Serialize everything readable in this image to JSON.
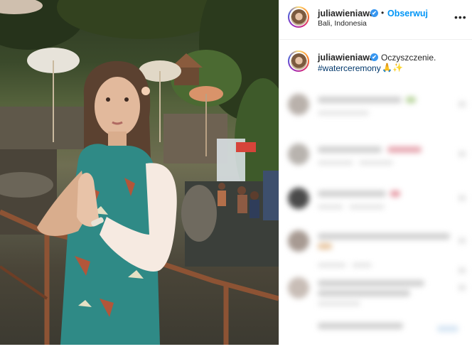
{
  "post": {
    "username": "juliawieniawa",
    "follow_label": "Obserwuj",
    "separator": "•",
    "location": "Bali, Indonesia",
    "more_label": "•••",
    "verified_mark": "✔"
  },
  "caption": {
    "username": "juliawieniawa",
    "text": "Oczyszczenie.",
    "hashtag": "#waterceremony",
    "emojis": "🙏✨"
  },
  "comments_blurred_count": 7,
  "icons": {
    "verified": "verified-badge-icon",
    "more": "more-options-icon"
  },
  "colors": {
    "accent": "#0095f6",
    "hashtag": "#00376b",
    "text": "#262626",
    "verified": "#3897f0"
  }
}
